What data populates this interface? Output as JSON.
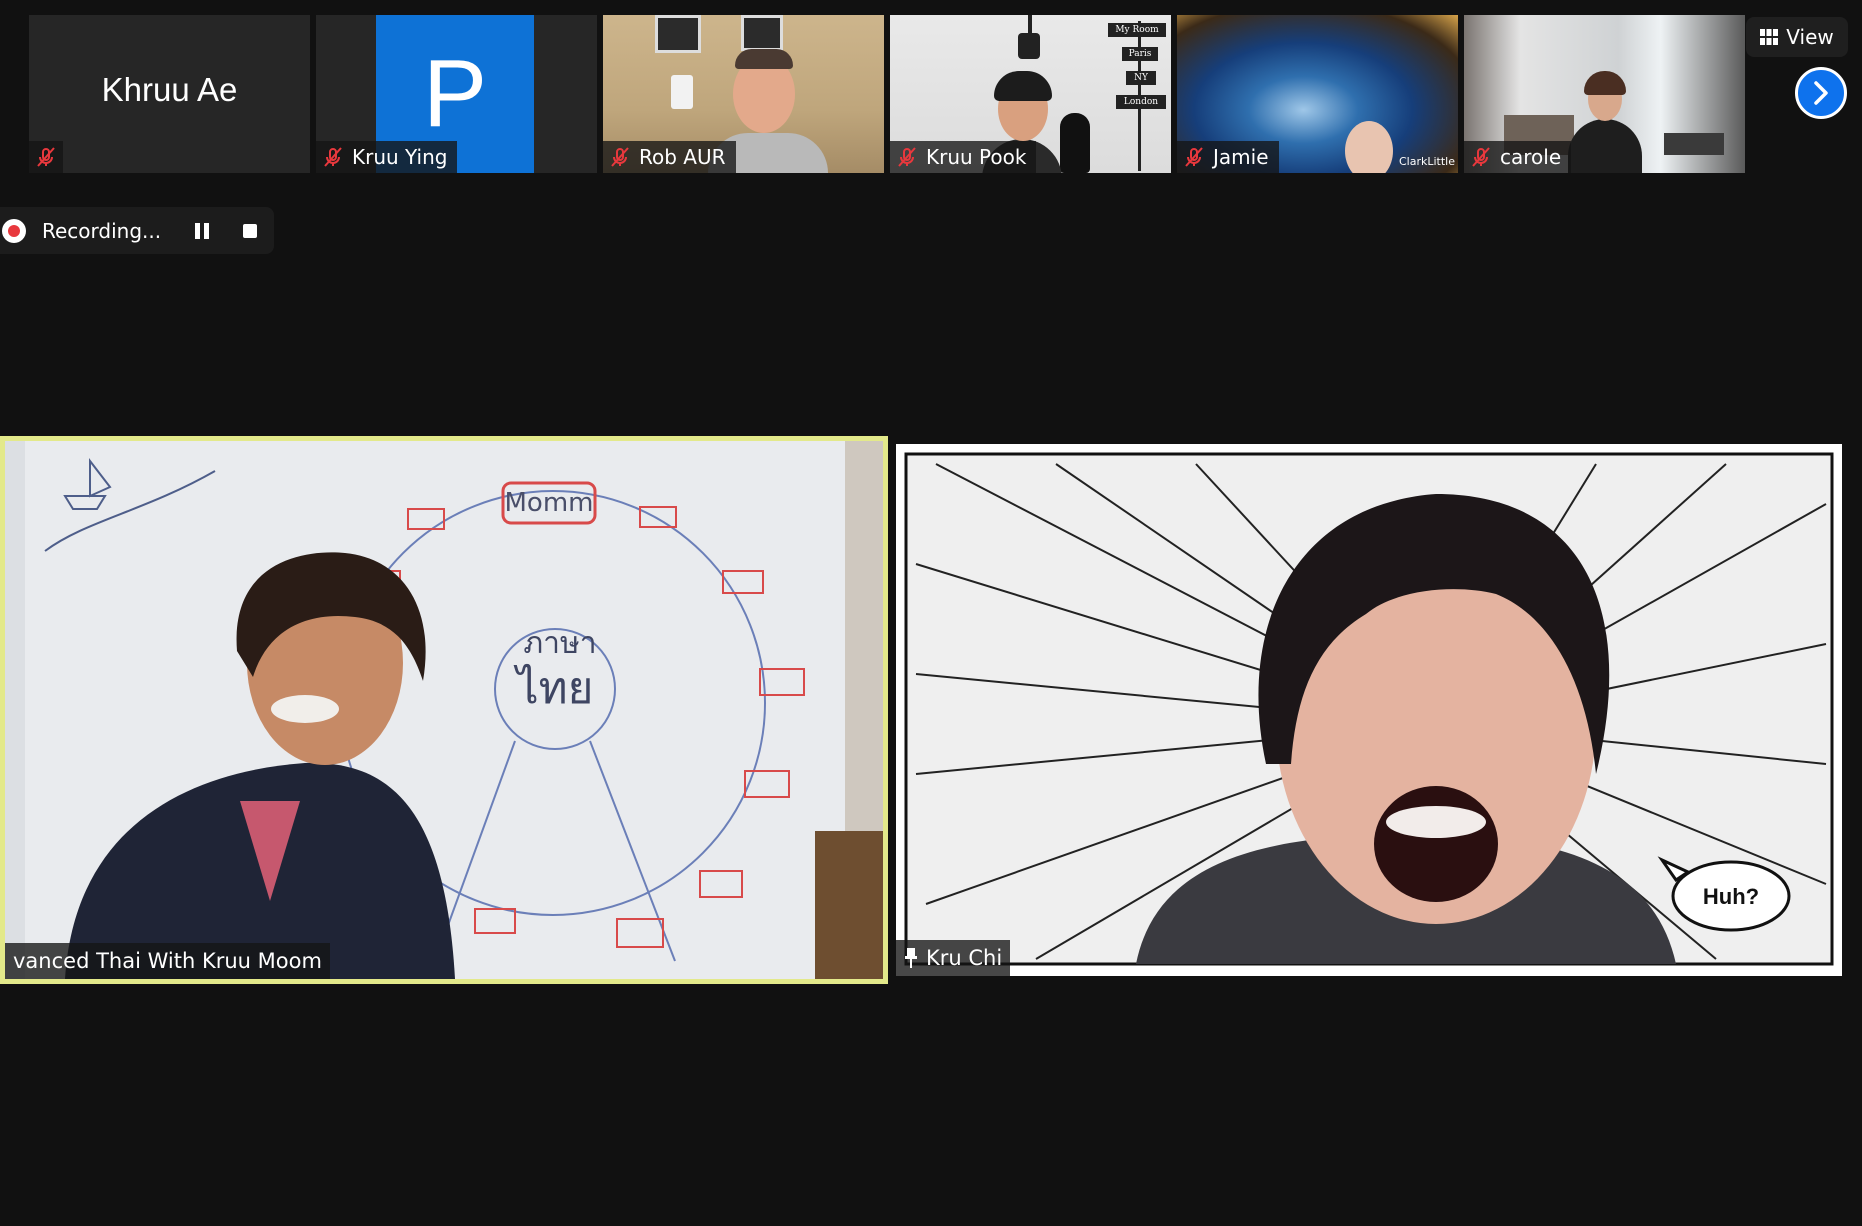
{
  "participants": [
    {
      "name": "Khruu Ae",
      "tag": ""
    },
    {
      "name": "Kruu Ying",
      "avatar_letter": "P"
    },
    {
      "name": "Rob AUR"
    },
    {
      "name": "Kruu Pook"
    },
    {
      "name": "Jamie"
    },
    {
      "name": "carole"
    }
  ],
  "toolbar": {
    "view_label": "View",
    "view_icon": "grid-icon",
    "next_icon": "chevron-right-icon"
  },
  "recording": {
    "label": "Recording...",
    "pause_icon": "pause-icon",
    "stop_icon": "stop-icon",
    "dot_color": "#e8383d"
  },
  "main": {
    "left": {
      "name": "vanced Thai With Kruu Moom",
      "whiteboard_word": "Momm",
      "whiteboard_thai_top": "ภาษา",
      "whiteboard_thai_bottom": "ไทย",
      "highlight_color": "#e3e98a"
    },
    "right": {
      "name": "Kru Chi",
      "bubble_text": "Huh?",
      "pin_icon": "pin-icon"
    }
  },
  "thumb_text": {
    "watermark": "ClarkLittle"
  },
  "signs": [
    "My Room",
    "Paris",
    "NY",
    "London"
  ],
  "colors": {
    "accent": "#0e72ed",
    "background": "#111111",
    "muted_red": "#e8383d"
  }
}
